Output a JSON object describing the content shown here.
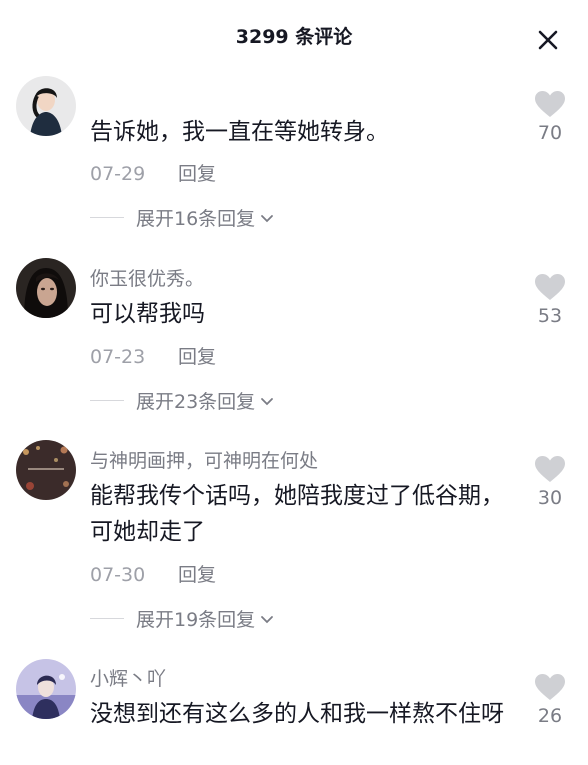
{
  "header": {
    "title": "3299 条评论"
  },
  "comments": [
    {
      "username": "",
      "text": "告诉她，我一直在等她转身。",
      "date": "07-29",
      "reply_label": "回复",
      "expand_label": "展开16条回复",
      "likes": "70"
    },
    {
      "username": "你玉很优秀。",
      "text": "可以帮我吗",
      "date": "07-23",
      "reply_label": "回复",
      "expand_label": "展开23条回复",
      "likes": "53"
    },
    {
      "username": "与神明画押，可神明在何处",
      "text": "能帮我传个话吗，她陪我度过了低谷期，可她却走了",
      "date": "07-30",
      "reply_label": "回复",
      "expand_label": "展开19条回复",
      "likes": "30"
    },
    {
      "username": "小辉丶吖",
      "text": "没想到还有这么多的人和我一样熬不住呀",
      "likes": "26"
    }
  ],
  "icons": {
    "close": "close-icon",
    "like": "heart-icon",
    "expand": "chevron-down-icon"
  },
  "colors": {
    "primary_text": "#161823",
    "secondary_text": "#7a7c85",
    "muted_text": "#9ea0a8",
    "heart": "#cfd0d4"
  }
}
